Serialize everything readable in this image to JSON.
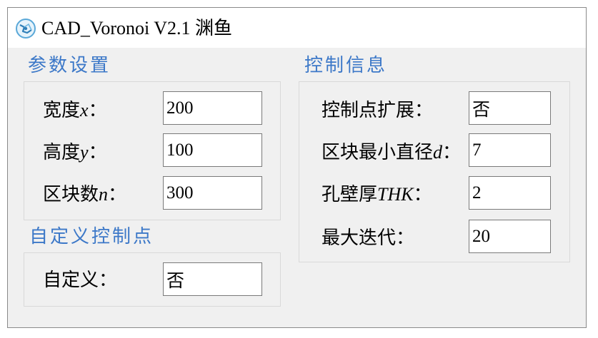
{
  "window": {
    "title": "CAD_Voronoi V2.1 渊鱼"
  },
  "params": {
    "title": "参数设置",
    "width": {
      "label": "宽度",
      "var": "x",
      "colon": "：",
      "value": "200"
    },
    "height": {
      "label": "高度",
      "var": "y",
      "colon": "：",
      "value": "100"
    },
    "blocks": {
      "label": "区块数",
      "var": "n",
      "colon": "：",
      "value": "300"
    }
  },
  "custom": {
    "title": "自定义控制点",
    "custom_field": {
      "label": "自定义：",
      "value": "否"
    }
  },
  "control": {
    "title": "控制信息",
    "expand": {
      "label": "控制点扩展：",
      "value": "否"
    },
    "min_diam": {
      "label": "区块最小直径",
      "var": "d",
      "colon": "：",
      "value": "7"
    },
    "wall": {
      "label": "孔壁厚",
      "var": "THK",
      "colon": "：",
      "value": "2"
    },
    "max_iter": {
      "label": "最大迭代：",
      "value": "20"
    }
  }
}
